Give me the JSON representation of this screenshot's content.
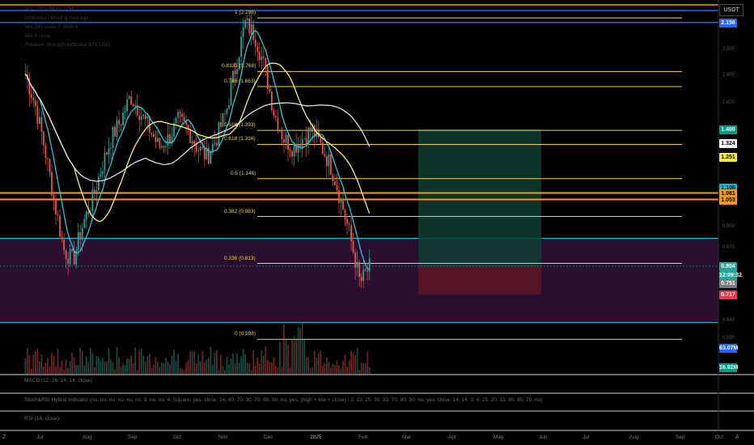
{
  "header": {
    "currency": "USDT",
    "legend": [
      "Vol · 16.92M  63.07M",
      "Ichimoku / Moving Average",
      "MA 200 close 0 SMA 9",
      "MA 9 close",
      "Relative Strength Indicator BTCUSD"
    ]
  },
  "price_tags": [
    {
      "text": "2.156",
      "bg": "#2962ff",
      "fg": "#ffffff",
      "price": 2.156
    },
    {
      "text": "1.400",
      "bg": "#089981",
      "fg": "#ffffff",
      "price": 1.4
    },
    {
      "text": "1.324",
      "bg": "#ffffff",
      "fg": "#000000",
      "price": 1.324
    },
    {
      "text": "1.251",
      "bg": "#ffeb3b",
      "fg": "#000000",
      "price": 1.251
    },
    {
      "text": "1.106",
      "bg": "#00bcd4",
      "fg": "#000000",
      "price": 1.106
    },
    {
      "text": "1.081",
      "bg": "#ff9800",
      "fg": "#000000",
      "price": 1.081
    },
    {
      "text": "1.053",
      "bg": "#ff9800",
      "fg": "#000000",
      "price": 1.053
    },
    {
      "text": "0.804",
      "bg": "#26a69a",
      "fg": "#ffffff",
      "price": 0.804
    },
    {
      "text": "12:09:32",
      "bg": "#26a69a",
      "fg": "#ffffff",
      "price": 0.785
    },
    {
      "text": "0.751",
      "bg": "#787b86",
      "fg": "#ffffff",
      "price": 0.751
    },
    {
      "text": "0.717",
      "bg": "#f23645",
      "fg": "#ffffff",
      "price": 0.717
    },
    {
      "text": "63.07M",
      "bg": "#2962ff",
      "fg": "#ffffff",
      "price": 0.53
    },
    {
      "text": "16.92M",
      "bg": "#089981",
      "fg": "#ffffff",
      "price": 0.46
    }
  ],
  "axis_ticks": [
    "2.000",
    "1.800",
    "1.600",
    "0.900",
    "0.870",
    "0.640",
    "0.590"
  ],
  "fib_labels": [
    "1 (2.196)",
    "0.8333 (1.768)",
    "0.786 (1.663)",
    "0.618 (1.393)",
    "0.618 (1.316)",
    "0.5 (1.146)",
    "0.382 (0.983)",
    "0.236 (0.813)",
    "0 (0.598)"
  ],
  "panes": [
    "MACD (12, 26, 14, 14, close)",
    "Stoch&RSI Hybrid Indicator (no, no, no, no, no, ns, 3, no, no, 4, Square, yes, close, 14, 40, 70, 30, 70, 80, 90, no, yes, (high + low + close) / 3, 13, 25, 30, 33, 70, 80, 90, no, yes, close, 14, 14, 3, 4, 25, 20, 13, 80, 85, 70, no)",
    "RSI (14, close)"
  ],
  "months": [
    "Jul",
    "Aug",
    "Sep",
    "Oct",
    "Nov",
    "Dec",
    "2025",
    "Feb",
    "Mar",
    "Apr",
    "May",
    "Jun",
    "Jul",
    "Aug",
    "Sep",
    "Oct"
  ],
  "colors": {
    "bull": "#26a69a",
    "bear": "#ef5350",
    "ma_fast": "#26c6da",
    "ma_mid": "#fff176",
    "ma_slow": "#e0e0e0",
    "fib": "#f0d54c",
    "zone": "#2a0f2e",
    "zone_border": "#26c6da",
    "orange": "#ff9800",
    "blue": "#2962ff",
    "long_tp": "#0e3d33",
    "long_sl": "#5b1523"
  },
  "chart_data": {
    "type": "candlestick",
    "y_scale": "log",
    "horizontal_levels": [
      {
        "price": 2.196,
        "label": "1 (2.196)"
      },
      {
        "price": 1.768,
        "label": "0.8333 (1.768)"
      },
      {
        "price": 1.663,
        "label": "0.786 (1.663)"
      },
      {
        "price": 1.393,
        "label": "0.618 (1.393)"
      },
      {
        "price": 1.316,
        "label": "0.618 (1.316)"
      },
      {
        "price": 1.146,
        "label": "0.5 (1.146)"
      },
      {
        "price": 0.983,
        "label": "0.382 (0.983)"
      },
      {
        "price": 0.813,
        "label": "0.236 (0.813)"
      },
      {
        "price": 0.598,
        "label": "0 (0.598)"
      }
    ],
    "support_zone": [
      0.64,
      0.9
    ],
    "orange_levels": [
      1.081,
      1.053
    ],
    "blue_level": 2.156,
    "position": {
      "type": "long",
      "entry": 0.804,
      "target": 1.4,
      "stop": 0.717
    },
    "last_price": 0.804,
    "price_path": [
      1.75,
      1.55,
      1.3,
      1.05,
      0.86,
      0.82,
      0.95,
      1.05,
      1.2,
      1.35,
      1.45,
      1.6,
      1.5,
      1.4,
      1.3,
      1.35,
      1.45,
      1.4,
      1.3,
      1.25,
      1.35,
      1.5,
      1.8,
      2.15,
      2.05,
      1.8,
      1.5,
      1.35,
      1.3,
      1.35,
      1.4,
      1.3,
      1.2,
      1.05,
      0.9,
      0.75,
      0.8
    ]
  }
}
